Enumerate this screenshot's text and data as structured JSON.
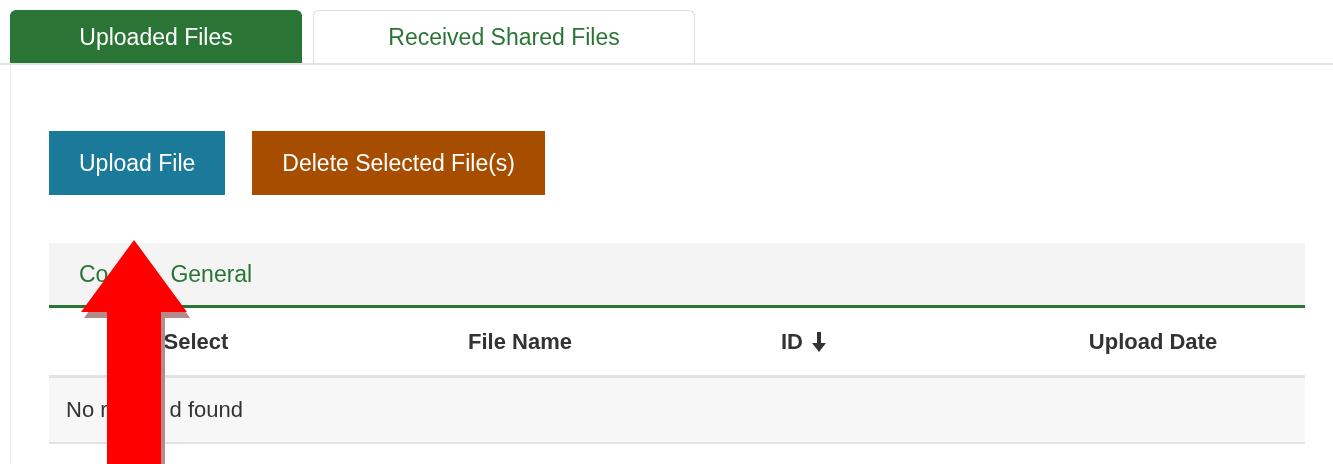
{
  "tabs": [
    {
      "label": "Uploaded Files",
      "selected": true
    },
    {
      "label": "Received Shared Files",
      "selected": false
    }
  ],
  "buttons": [
    {
      "label": "Upload File",
      "kind": "upload"
    },
    {
      "label": "Delete Selected File(s)",
      "kind": "delete"
    }
  ],
  "table": {
    "group_label_parts": [
      "Co",
      "General"
    ],
    "columns": [
      {
        "label": "Select"
      },
      {
        "label": "File Name"
      },
      {
        "label": "ID",
        "sorted": true
      },
      {
        "label": "Upload Date"
      }
    ],
    "empty_message_parts": [
      "No r",
      "d found"
    ]
  }
}
